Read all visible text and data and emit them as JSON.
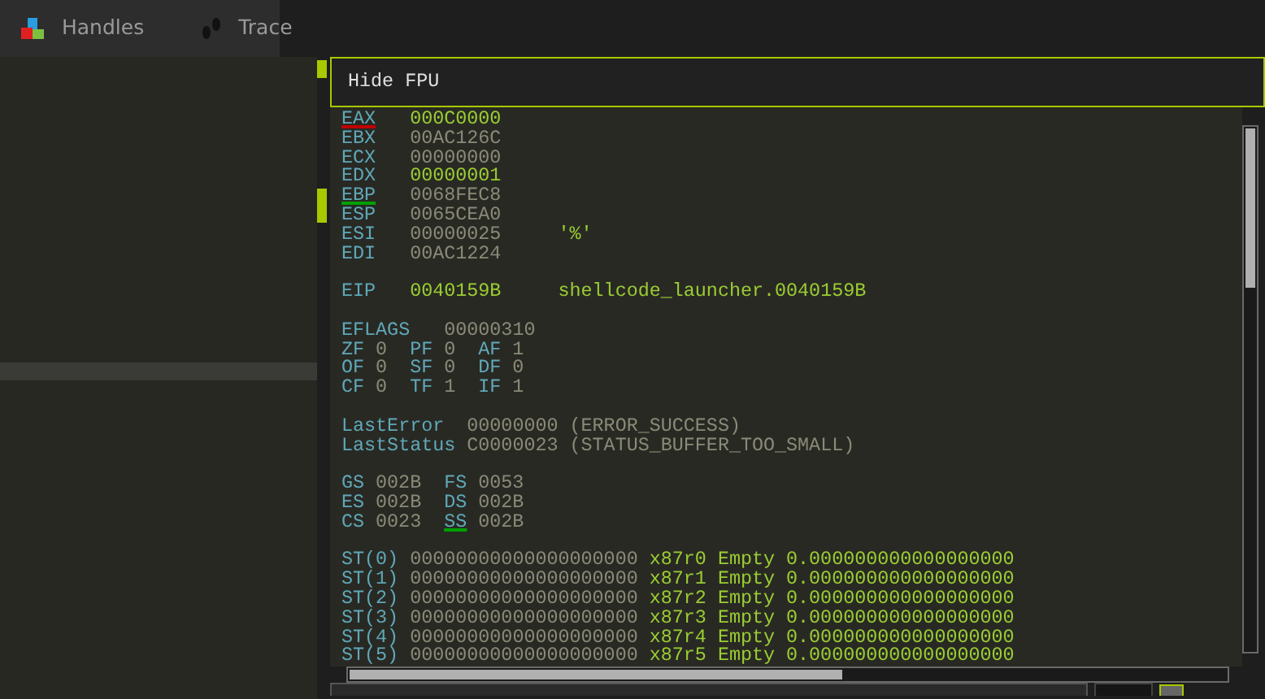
{
  "tabs": [
    {
      "label": "Handles",
      "kind": "blocks"
    },
    {
      "label": "Trace",
      "kind": "footprints"
    }
  ],
  "fpu_toggle": {
    "label": "Hide FPU"
  },
  "registers": [
    {
      "name": "EAX",
      "value": "000C0000",
      "changed": true,
      "color": "#c00000"
    },
    {
      "name": "EBX",
      "value": "00AC126C",
      "changed": false
    },
    {
      "name": "ECX",
      "value": "00000000",
      "changed": false
    },
    {
      "name": "EDX",
      "value": "00000001",
      "changed": true
    },
    {
      "name": "EBP",
      "value": "0068FEC8",
      "changed": false,
      "color": "#00a000"
    },
    {
      "name": "ESP",
      "value": "0065CEA0",
      "changed": false
    },
    {
      "name": "ESI",
      "value": "00000025",
      "changed": false,
      "comment": "'%'"
    },
    {
      "name": "EDI",
      "value": "00AC1224",
      "changed": false
    }
  ],
  "instruction_pointer": {
    "name": "EIP",
    "value": "0040159B",
    "changed": true,
    "comment": "shellcode_launcher.0040159B"
  },
  "eflags": {
    "name": "EFLAGS",
    "value": "00000310"
  },
  "flags": [
    [
      {
        "name": "ZF",
        "value": "0"
      },
      {
        "name": "PF",
        "value": "0"
      },
      {
        "name": "AF",
        "value": "1"
      }
    ],
    [
      {
        "name": "OF",
        "value": "0"
      },
      {
        "name": "SF",
        "value": "0"
      },
      {
        "name": "DF",
        "value": "0"
      }
    ],
    [
      {
        "name": "CF",
        "value": "0"
      },
      {
        "name": "TF",
        "value": "1"
      },
      {
        "name": "IF",
        "value": "1"
      }
    ]
  ],
  "last_error": {
    "name": "LastError",
    "value": "00000000 (ERROR_SUCCESS)"
  },
  "last_status": {
    "name": "LastStatus",
    "value": "C0000023 (STATUS_BUFFER_TOO_SMALL)"
  },
  "segments": [
    [
      {
        "name": "GS",
        "value": "002B"
      },
      {
        "name": "FS",
        "value": "0053"
      }
    ],
    [
      {
        "name": "ES",
        "value": "002B"
      },
      {
        "name": "DS",
        "value": "002B"
      }
    ],
    [
      {
        "name": "CS",
        "value": "0023"
      },
      {
        "name": "SS",
        "value": "002B",
        "color": "#00a000"
      }
    ]
  ],
  "fpu": [
    {
      "name": "ST(0)",
      "raw": "00000000000000000000",
      "register": "x87r0",
      "tag": "Empty",
      "value": "0.000000000000000000"
    },
    {
      "name": "ST(1)",
      "raw": "00000000000000000000",
      "register": "x87r1",
      "tag": "Empty",
      "value": "0.000000000000000000"
    },
    {
      "name": "ST(2)",
      "raw": "00000000000000000000",
      "register": "x87r2",
      "tag": "Empty",
      "value": "0.000000000000000000"
    },
    {
      "name": "ST(3)",
      "raw": "00000000000000000000",
      "register": "x87r3",
      "tag": "Empty",
      "value": "0.000000000000000000"
    },
    {
      "name": "ST(4)",
      "raw": "00000000000000000000",
      "register": "x87r4",
      "tag": "Empty",
      "value": "0.000000000000000000"
    },
    {
      "name": "ST(5)",
      "raw": "00000000000000000000",
      "register": "x87r5",
      "tag": "Empty",
      "value": "0.000000000000000000"
    }
  ]
}
